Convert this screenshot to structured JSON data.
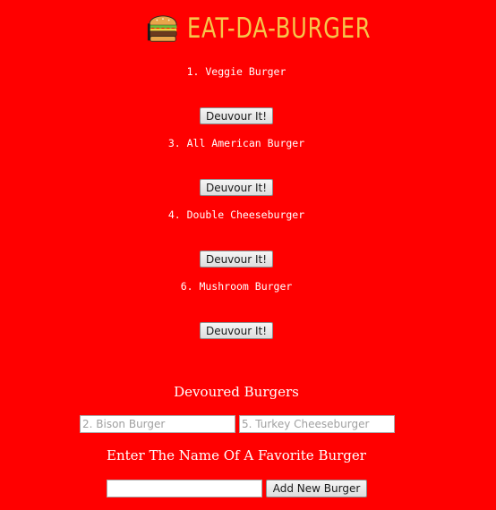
{
  "header": {
    "logo_icon": "burger-icon",
    "title": "EAT-DA-BURGER",
    "title_color": "#f6c64a"
  },
  "background_color": "#ff0000",
  "burgers": [
    {
      "name": "1. Veggie Burger",
      "button_label": "Deuvour It!"
    },
    {
      "name": "3. All American Burger",
      "button_label": "Deuvour It!"
    },
    {
      "name": "4. Double Cheeseburger",
      "button_label": "Deuvour It!"
    },
    {
      "name": "6. Mushroom Burger",
      "button_label": "Deuvour It!"
    }
  ],
  "devoured": {
    "title": "Devoured Burgers",
    "items": [
      "2. Bison Burger",
      "5. Turkey Cheeseburger"
    ]
  },
  "form": {
    "title": "Enter The Name Of A Favorite Burger",
    "input_value": "",
    "submit_label": "Add New Burger"
  }
}
